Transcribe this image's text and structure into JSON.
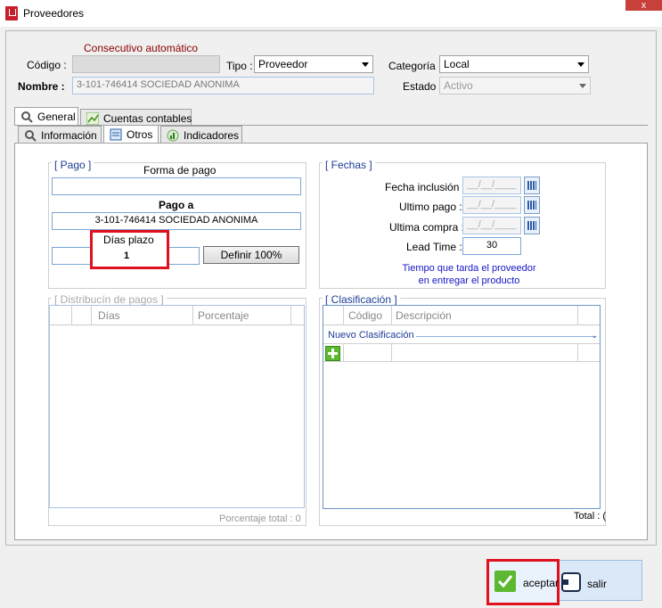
{
  "window": {
    "title": "Proveedores",
    "close_label": "x"
  },
  "header": {
    "consecutivo_note": "Consecutivo automático",
    "codigo_label": "Código :",
    "codigo_value": "",
    "tipo_label": "Tipo :",
    "tipo_value": "Proveedor",
    "categoria_label": "Categoría :",
    "categoria_value": "Local",
    "nombre_label": "Nombre :",
    "nombre_value": "3-101-746414 SOCIEDAD ANONIMA",
    "estado_label": "Estado :",
    "estado_value": "Activo"
  },
  "tabs_outer": [
    {
      "label": "General",
      "icon": "search-icon"
    },
    {
      "label": "Cuentas contables",
      "icon": "chart-icon"
    }
  ],
  "tabs_inner": [
    {
      "label": "Información",
      "icon": "search-icon"
    },
    {
      "label": "Otros",
      "icon": "document-icon"
    },
    {
      "label": "Indicadores",
      "icon": "bar-chart-icon"
    }
  ],
  "pago": {
    "group_title": "[ Pago ]",
    "forma_label": "Forma de pago",
    "forma_value": "",
    "pago_a_label": "Pago a",
    "pago_a_value": "3-101-746414 SOCIEDAD ANONIMA",
    "dias_label": "Días plazo",
    "dias_value": "1",
    "definir_button": "Definir 100%"
  },
  "fechas": {
    "group_title": "[ Fechas ]",
    "inclusion_label": "Fecha inclusión :",
    "inclusion_value": "__/__/____",
    "ultimo_pago_label": "Ultimo pago :",
    "ultimo_pago_value": "__/__/____",
    "ultima_compra_label": "Ultima compra :",
    "ultima_compra_value": "__/__/____",
    "lead_time_label": "Lead Time :",
    "lead_time_value": "30",
    "lead_note_1": "Tiempo que tarda el proveedor",
    "lead_note_2": "en entregar el producto"
  },
  "distribucion": {
    "group_title": "[ Distribucín de pagos ]",
    "columns": [
      "Días",
      "Porcentaje"
    ],
    "total_label": "Porcentaje total : 0"
  },
  "clasificacion": {
    "group_title": "[ Clasificación ]",
    "columns": [
      "Código",
      "Descripción"
    ],
    "new_row_label": "Nuevo Clasificación",
    "total_label": "Total : ("
  },
  "footer": {
    "accept_label": "aceptar",
    "exit_label": "salir"
  },
  "colors": {
    "accent": "#1e3c96",
    "highlight": "#e0101c",
    "accept": "#5cb82e"
  }
}
